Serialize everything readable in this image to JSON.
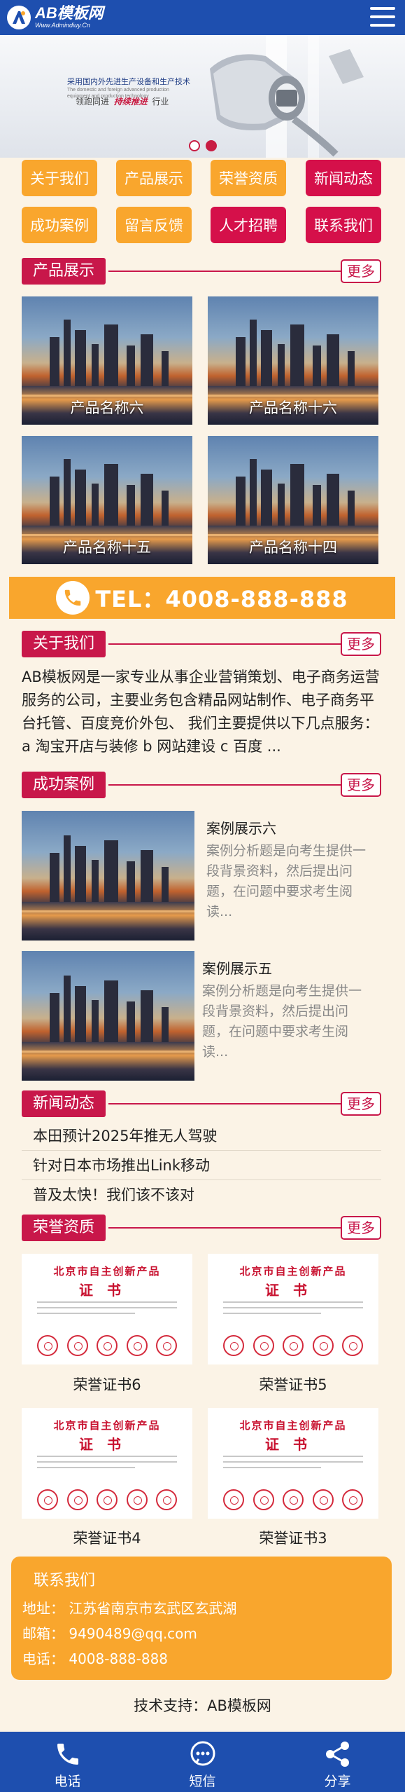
{
  "header": {
    "logo_title": "AB模板网",
    "logo_subtitle": "Www.Admindiuy.Cn",
    "logo_icon": "logo-a-icon",
    "menu_icon": "hamburger-menu-icon"
  },
  "banner": {
    "line1": "采用国内外先进生产设备和生产技术",
    "line2": "The domestic and foreign advanced production equipment and production technology",
    "line3_prefix": "领跑同进",
    "line3_highlight": "持续推进",
    "line3_suffix": "行业",
    "slides": 2,
    "active_slide": 2
  },
  "nav": {
    "items": [
      {
        "label": "关于我们",
        "color": "yellow"
      },
      {
        "label": "产品展示",
        "color": "yellow"
      },
      {
        "label": "荣誉资质",
        "color": "yellow"
      },
      {
        "label": "新闻动态",
        "color": "red"
      },
      {
        "label": "成功案例",
        "color": "yellow"
      },
      {
        "label": "留言反馈",
        "color": "yellow"
      },
      {
        "label": "人才招聘",
        "color": "red"
      },
      {
        "label": "联系我们",
        "color": "red"
      }
    ]
  },
  "sections": {
    "products": {
      "title": "产品展示",
      "more": "更多"
    },
    "about": {
      "title": "关于我们",
      "more": "更多"
    },
    "cases": {
      "title": "成功案例",
      "more": "更多"
    },
    "news": {
      "title": "新闻动态",
      "more": "更多"
    },
    "honors": {
      "title": "荣誉资质",
      "more": "更多"
    }
  },
  "products": [
    {
      "name": "产品名称六"
    },
    {
      "name": "产品名称十六"
    },
    {
      "name": "产品名称十五"
    },
    {
      "name": "产品名称十四"
    }
  ],
  "tel_bar": {
    "text": "TEL：4008-888-888",
    "icon": "phone-icon"
  },
  "about": {
    "text": "AB模板网是一家专业从事企业营销策划、电子商务运营服务的公司，主要业务包含精品网站制作、电子商务平台托管、百度竞价外包、 我们主要提供以下几点服务： a 淘宝开店与装修 b 网站建设 c 百度 ..."
  },
  "cases": [
    {
      "title": "案例展示六",
      "desc": "案例分析题是向考生提供一段背景资料，然后提出问题，在问题中要求考生阅读..."
    },
    {
      "title": "案例展示五",
      "desc": "案例分析题是向考生提供一段背景资料，然后提出问题，在问题中要求考生阅读..."
    }
  ],
  "news": [
    {
      "title": "本田预计2025年推无人驾驶"
    },
    {
      "title": "针对日本市场推出Link移动"
    },
    {
      "title": "普及太快！我们该不该对"
    }
  ],
  "certificates": {
    "heading": "北京市自主创新产品",
    "word": "证书",
    "items": [
      {
        "name": "荣誉证书6"
      },
      {
        "name": "荣誉证书5"
      },
      {
        "name": "荣誉证书4"
      },
      {
        "name": "荣誉证书3"
      }
    ]
  },
  "contact": {
    "title": "联系我们",
    "address": "地址：  江苏省南京市玄武区玄武湖",
    "email": "邮箱：  9490489@qq.com",
    "phone": "电话：  4008-888-888"
  },
  "support": "技术支持：AB模板网",
  "footer": {
    "items": [
      {
        "label": "电话",
        "icon": "phone-icon"
      },
      {
        "label": "短信",
        "icon": "sms-chat-icon"
      },
      {
        "label": "分享",
        "icon": "share-icon"
      }
    ]
  },
  "colors": {
    "header_blue": "#1e4faf",
    "accent_red": "#c8174a",
    "accent_yellow": "#f9a62d",
    "page_bg": "#fbf3e6"
  }
}
